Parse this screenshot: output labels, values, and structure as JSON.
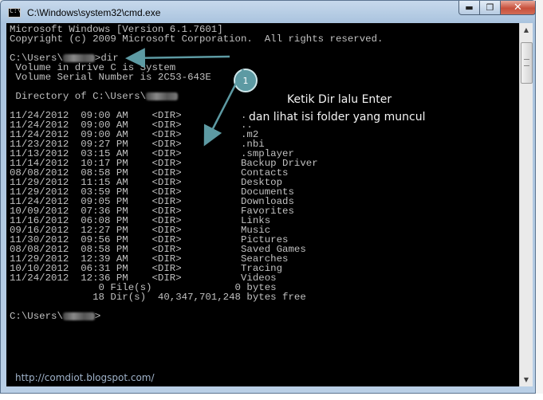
{
  "window": {
    "title": "C:\\Windows\\system32\\cmd.exe",
    "icon": "cmd-icon",
    "controls": {
      "minimize": "▬",
      "maximize": "❐",
      "close": "✕"
    }
  },
  "console": {
    "prompt_user_hidden": true,
    "lines": [
      "Microsoft Windows [Version 6.1.7601]",
      "Copyright (c) 2009 Microsoft Corporation.  All rights reserved.",
      "",
      "C:\\Users\\[blurred]>dir",
      " Volume in drive C is System",
      " Volume Serial Number is 2C53-643E",
      "",
      " Directory of C:\\Users\\[blurred]",
      "",
      "11/24/2012  09:00 AM    <DIR>          .",
      "11/24/2012  09:00 AM    <DIR>          ..",
      "11/24/2012  09:00 AM    <DIR>          .m2",
      "11/23/2012  09:27 PM    <DIR>          .nbi",
      "11/13/2012  03:15 AM    <DIR>          .smplayer",
      "11/14/2012  10:17 PM    <DIR>          Backup Driver",
      "08/08/2012  08:58 PM    <DIR>          Contacts",
      "11/29/2012  11:15 AM    <DIR>          Desktop",
      "11/29/2012  03:59 PM    <DIR>          Documents",
      "11/24/2012  09:05 PM    <DIR>          Downloads",
      "10/09/2012  07:36 PM    <DIR>          Favorites",
      "11/16/2012  06:08 PM    <DIR>          Links",
      "09/16/2012  12:27 PM    <DIR>          Music",
      "11/30/2012  09:56 PM    <DIR>          Pictures",
      "08/08/2012  08:58 PM    <DIR>          Saved Games",
      "11/29/2012  12:39 AM    <DIR>          Searches",
      "10/10/2012  06:31 PM    <DIR>          Tracing",
      "11/24/2012  12:36 PM    <DIR>          Videos",
      "               0 File(s)              0 bytes",
      "              18 Dir(s)  40,347,701,248 bytes free",
      "",
      "C:\\Users\\[blurred]>"
    ]
  },
  "annotation": {
    "badge": "1",
    "line1": "Ketik Dir lalu Enter",
    "line2": "dan lihat isi folder yang muncul",
    "color": "#5d9aa3"
  },
  "watermark": "http://comdiot.blogspot.com/"
}
